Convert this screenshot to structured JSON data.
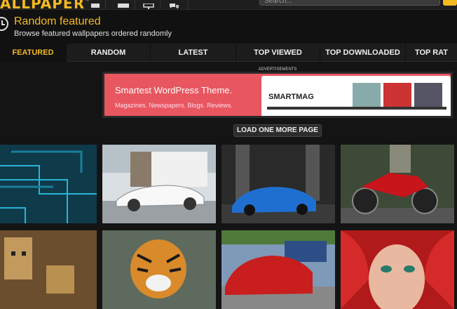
{
  "topbar": {
    "logo_text": "ALLPAPER",
    "search_placeholder": "Search..."
  },
  "header": {
    "title": "Random featured",
    "subtitle": "Browse featured wallpapers ordered randomly"
  },
  "tabs": [
    {
      "label": "FEATURED",
      "active": true
    },
    {
      "label": "RANDOM",
      "active": false
    },
    {
      "label": "LATEST",
      "active": false
    },
    {
      "label": "TOP VIEWED",
      "active": false
    },
    {
      "label": "TOP DOWNLOADED",
      "active": false
    },
    {
      "label": "TOP RAT",
      "active": false
    }
  ],
  "ad": {
    "label": "ADVERTISEMENTS",
    "headline": "Smartest WordPress Theme.",
    "subline": "Magazines. Newspapers. Blogs. Reviews.",
    "brand": "SMARTMAG"
  },
  "load_more_label": "LOAD ONE MORE PAGE",
  "wallpapers": [
    {
      "subject": "abstract-teal-circuit"
    },
    {
      "subject": "white-mercedes-sls"
    },
    {
      "subject": "blue-corvette"
    },
    {
      "subject": "red-ducati-motorcycle"
    },
    {
      "subject": "cardboard-robot"
    },
    {
      "subject": "tiger"
    },
    {
      "subject": "red-sports-car"
    },
    {
      "subject": "red-haired-woman"
    }
  ],
  "colors": {
    "accent": "#f5b921",
    "background": "#141414",
    "ad_red": "#e85660"
  }
}
